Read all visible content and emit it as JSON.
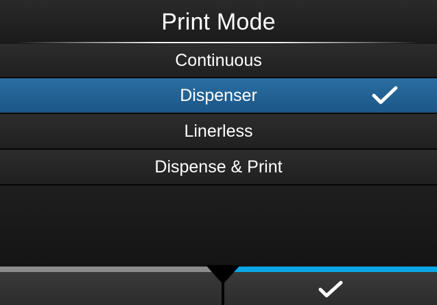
{
  "screen": {
    "title": "Print Mode"
  },
  "options": [
    {
      "label": "Continuous",
      "selected": false
    },
    {
      "label": "Dispenser",
      "selected": true
    },
    {
      "label": "Linerless",
      "selected": false
    },
    {
      "label": "Dispense & Print",
      "selected": false
    }
  ],
  "soft_keys": {
    "left": {
      "icon": "back-icon"
    },
    "right": {
      "icon": "check-icon"
    }
  },
  "colors": {
    "selected_row": "#1f5f92",
    "accent_blue": "#0aa6e6",
    "left_key_bar": "#8c8c8c"
  }
}
